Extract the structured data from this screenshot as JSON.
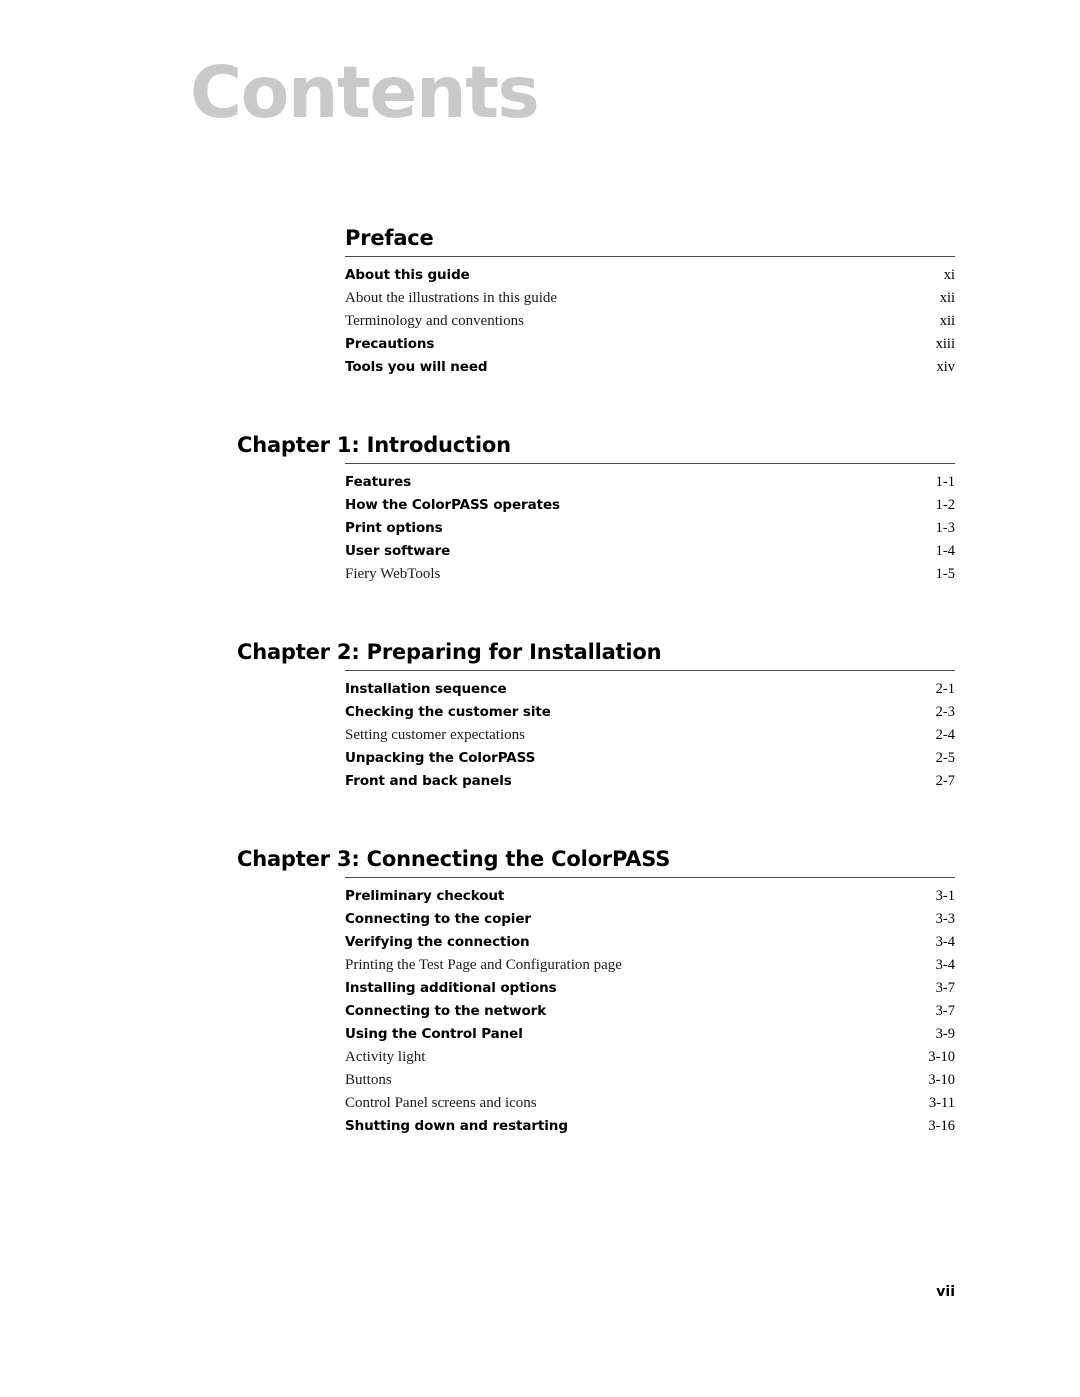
{
  "document": {
    "page_title": "Contents",
    "folio": "vii"
  },
  "sections": [
    {
      "chapter_label": "",
      "title": "Preface",
      "heading_full": "Preface",
      "entries": [
        {
          "level": 1,
          "label": "About this guide",
          "page": "xi"
        },
        {
          "level": 2,
          "label": "About the illustrations in this guide",
          "page": "xii"
        },
        {
          "level": 2,
          "label": "Terminology and conventions",
          "page": "xii"
        },
        {
          "level": 1,
          "label": "Precautions",
          "page": "xiii"
        },
        {
          "level": 1,
          "label": "Tools you will need",
          "page": "xiv"
        }
      ]
    },
    {
      "chapter_label": "Chapter 1:",
      "title": "Introduction",
      "heading_full": "Chapter 1: Introduction",
      "entries": [
        {
          "level": 1,
          "label": "Features",
          "page": "1-1"
        },
        {
          "level": 1,
          "label": "How the ColorPASS operates",
          "page": "1-2"
        },
        {
          "level": 1,
          "label": "Print options",
          "page": "1-3"
        },
        {
          "level": 1,
          "label": "User software",
          "page": "1-4"
        },
        {
          "level": 2,
          "label": "Fiery WebTools",
          "page": "1-5"
        }
      ]
    },
    {
      "chapter_label": "Chapter 2:",
      "title": "Preparing for Installation",
      "heading_full": "Chapter 2: Preparing for Installation",
      "entries": [
        {
          "level": 1,
          "label": "Installation sequence",
          "page": "2-1"
        },
        {
          "level": 1,
          "label": "Checking the customer site",
          "page": "2-3"
        },
        {
          "level": 2,
          "label": "Setting customer expectations",
          "page": "2-4"
        },
        {
          "level": 1,
          "label": "Unpacking the ColorPASS",
          "page": "2-5"
        },
        {
          "level": 1,
          "label": "Front and back panels",
          "page": "2-7"
        }
      ]
    },
    {
      "chapter_label": "Chapter 3:",
      "title": "Connecting the ColorPASS",
      "heading_full": "Chapter 3: Connecting the ColorPASS",
      "entries": [
        {
          "level": 1,
          "label": "Preliminary checkout",
          "page": "3-1"
        },
        {
          "level": 1,
          "label": "Connecting to the copier",
          "page": "3-3"
        },
        {
          "level": 1,
          "label": "Verifying the connection",
          "page": "3-4"
        },
        {
          "level": 2,
          "label": "Printing the Test Page and Configuration page",
          "page": "3-4"
        },
        {
          "level": 1,
          "label": "Installing additional options",
          "page": "3-7"
        },
        {
          "level": 1,
          "label": "Connecting to the network",
          "page": "3-7"
        },
        {
          "level": 1,
          "label": "Using the Control Panel",
          "page": "3-9"
        },
        {
          "level": 2,
          "label": "Activity light",
          "page": "3-10"
        },
        {
          "level": 2,
          "label": "Buttons",
          "page": "3-10"
        },
        {
          "level": 2,
          "label": "Control Panel screens and icons",
          "page": "3-11"
        },
        {
          "level": 1,
          "label": "Shutting down and restarting",
          "page": "3-16"
        }
      ]
    }
  ],
  "colors": {
    "page_title": "#c9c9c9",
    "rule": "#4a4a4a",
    "text": "#000000",
    "background": "#ffffff"
  }
}
